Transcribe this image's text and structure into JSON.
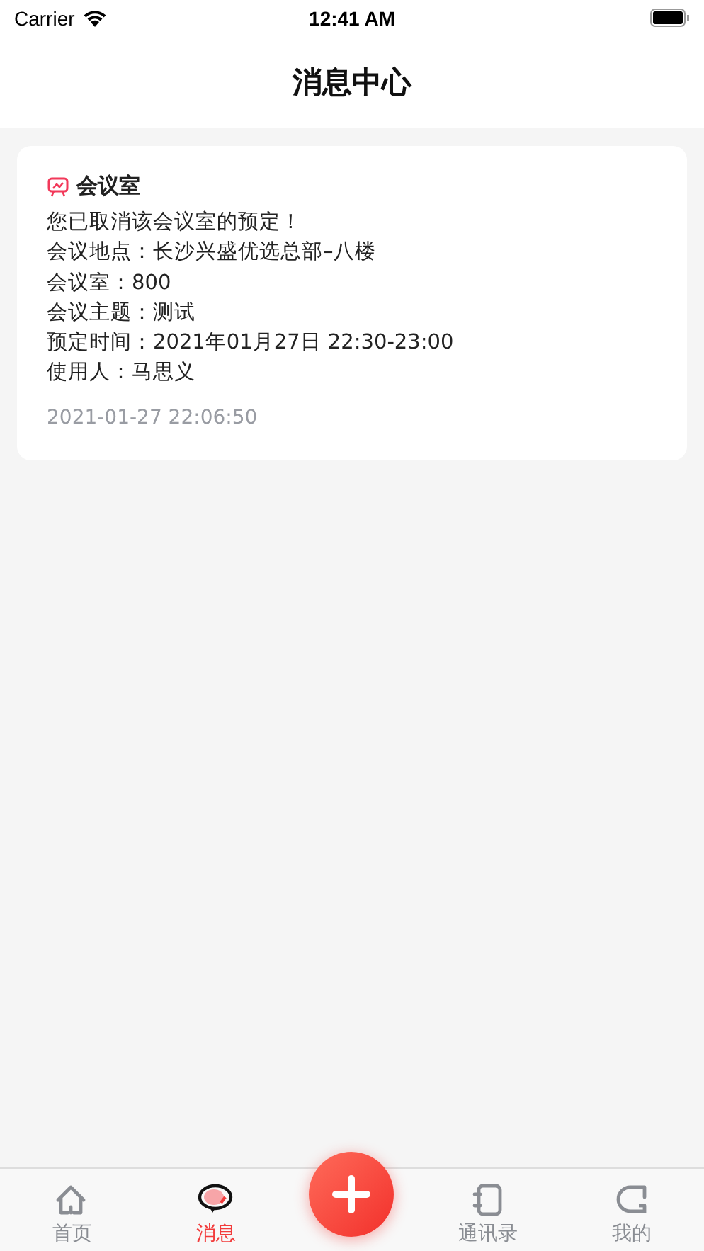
{
  "status_bar": {
    "carrier": "Carrier",
    "time": "12:41 AM"
  },
  "title": "消息中心",
  "messages": [
    {
      "category": "会议室",
      "lines": [
        "您已取消该会议室的预定！",
        "会议地点：长沙兴盛优选总部–八楼",
        "会议室：800",
        "会议主题：测试",
        "预定时间：2021年01月27日 22:30-23:00",
        "使用人：马思义"
      ],
      "timestamp": "2021-01-27 22:06:50"
    }
  ],
  "tab_bar": [
    {
      "kind": "home",
      "label": "首页",
      "selected": false
    },
    {
      "kind": "message",
      "label": "消息",
      "selected": true
    },
    {
      "kind": "add"
    },
    {
      "kind": "contacts",
      "label": "通讯录",
      "selected": false
    },
    {
      "kind": "me",
      "label": "我的",
      "selected": false
    }
  ]
}
